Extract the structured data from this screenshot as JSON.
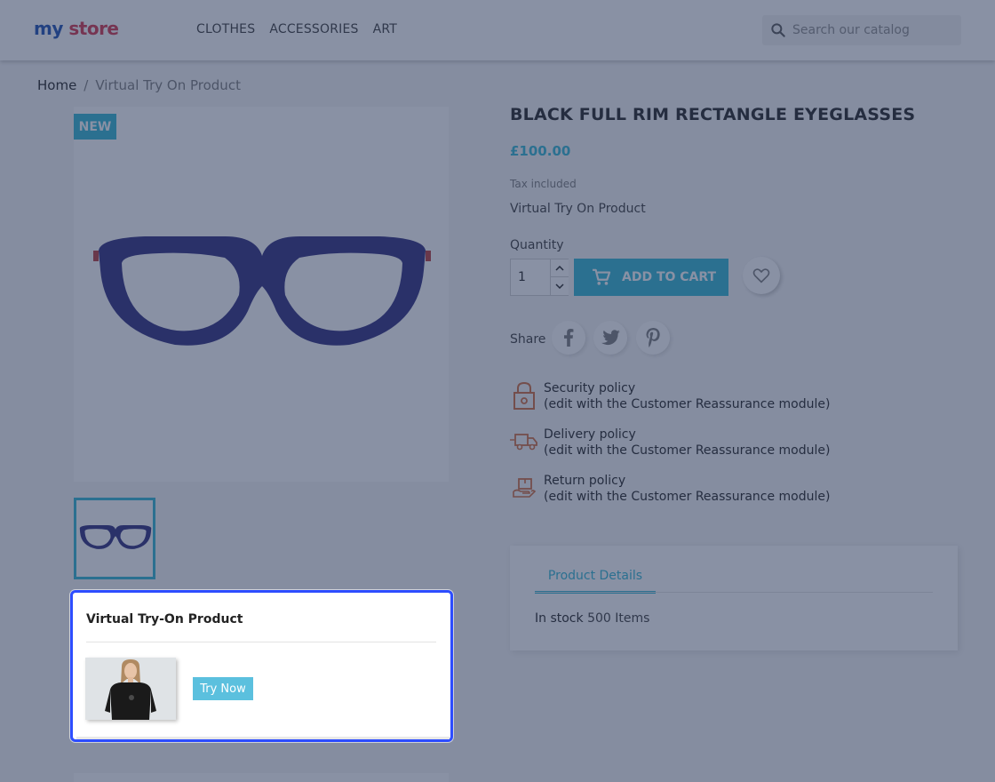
{
  "header": {
    "logo_part1": "my",
    "logo_part2": "store",
    "nav": [
      "CLOTHES",
      "ACCESSORIES",
      "ART"
    ],
    "search_placeholder": "Search our catalog"
  },
  "breadcrumb": {
    "home": "Home",
    "separator": "/",
    "current": "Virtual Try On Product"
  },
  "gallery": {
    "badge": "NEW"
  },
  "product": {
    "title": "BLACK FULL RIM RECTANGLE EYEGLASSES",
    "price": "£100.00",
    "tax_note": "Tax included",
    "short_description": "Virtual Try On Product",
    "quantity_label": "Quantity",
    "quantity_value": "1",
    "add_to_cart": "ADD TO CART",
    "share_label": "Share"
  },
  "policies": [
    {
      "title": "Security policy",
      "note": "(edit with the Customer Reassurance module)"
    },
    {
      "title": "Delivery policy",
      "note": "(edit with the Customer Reassurance module)"
    },
    {
      "title": "Return policy",
      "note": "(edit with the Customer Reassurance module)"
    }
  ],
  "details": {
    "tab": "Product Details",
    "stock_label": "In stock",
    "stock_value": "500 Items"
  },
  "vto": {
    "title": "Virtual Try-On Product",
    "button": "Try Now"
  },
  "colors": {
    "accent": "#2fb5d2",
    "modal_border": "#2d4dff",
    "try_now": "#5bc0de"
  }
}
